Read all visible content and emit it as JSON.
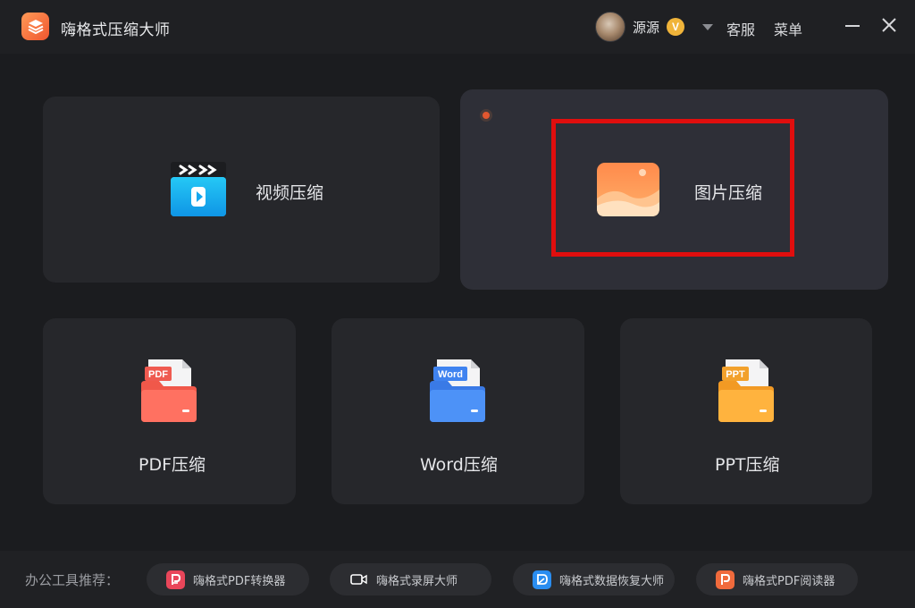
{
  "titlebar": {
    "app_title": "嗨格式压缩大师",
    "user_name": "源源",
    "vip_badge": "V",
    "service_label": "客服",
    "menu_label": "菜单"
  },
  "cards": {
    "video": {
      "label": "视频压缩"
    },
    "image": {
      "label": "图片压缩"
    },
    "pdf": {
      "label": "PDF压缩",
      "badge": "PDF",
      "color": "#ef5a50"
    },
    "word": {
      "label": "Word压缩",
      "badge": "Word",
      "color": "#3f83f0"
    },
    "ppt": {
      "label": "PPT压缩",
      "badge": "PPT",
      "color": "#f2a12c"
    }
  },
  "footer": {
    "label": "办公工具推荐：",
    "tools": [
      {
        "label": "嗨格式PDF转换器",
        "icon": "pdf-converter-icon",
        "color": "#e9465a"
      },
      {
        "label": "嗨格式录屏大师",
        "icon": "screen-recorder-icon",
        "color": "#1e1f23"
      },
      {
        "label": "嗨格式数据恢复大师",
        "icon": "data-recovery-icon",
        "color": "#2a8df0"
      },
      {
        "label": "嗨格式PDF阅读器",
        "icon": "pdf-reader-icon",
        "color": "#f06a3c"
      }
    ]
  },
  "colors": {
    "accent": "#e00e0e",
    "background": "#1b1c1f",
    "card": "#26272b",
    "card_active": "#2e2f37"
  }
}
